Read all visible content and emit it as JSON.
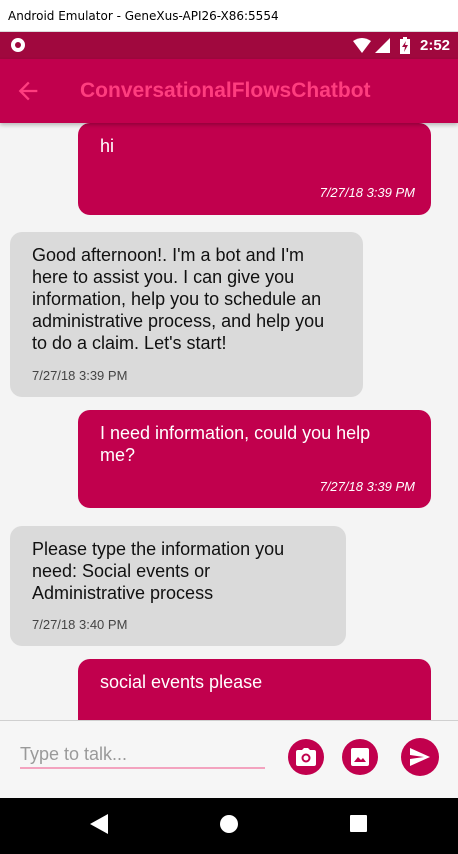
{
  "window": {
    "title": "Android Emulator - GeneXus-API26-X86:5554"
  },
  "status_bar": {
    "time": "2:52",
    "icons": [
      "notification-dot-icon",
      "wifi-icon",
      "cell-signal-icon",
      "battery-charging-icon"
    ]
  },
  "app_bar": {
    "title": "ConversationalFlowsChatbot",
    "back_icon": "arrow-left-icon"
  },
  "messages": [
    {
      "from": "user",
      "text": "hi",
      "time": "7/27/18 3:39 PM"
    },
    {
      "from": "bot",
      "text": "Good afternoon!. I'm a bot and I'm here to assist you. I can give you information, help you to schedule an administrative process, and help you to do a claim. Let's start!",
      "time": "7/27/18 3:39 PM"
    },
    {
      "from": "user",
      "text": "I need information, could you help me?",
      "time": "7/27/18 3:39 PM"
    },
    {
      "from": "bot",
      "text": "Please type the information you need: Social events or Administrative process",
      "time": "7/27/18 3:40 PM"
    },
    {
      "from": "user",
      "text": "social events please",
      "time": ""
    }
  ],
  "composer": {
    "placeholder": "Type to talk...",
    "buttons": [
      "camera-icon",
      "image-icon",
      "send-icon"
    ]
  },
  "nav_bar": {
    "icons": [
      "back-triangle-icon",
      "home-circle-icon",
      "recents-square-icon"
    ]
  },
  "colors": {
    "accent": "#c1004d",
    "status_bar": "#a0083e",
    "title_text": "#ff3d7f",
    "bot_bubble": "#dadada",
    "chat_background": "#f4f4f4"
  }
}
